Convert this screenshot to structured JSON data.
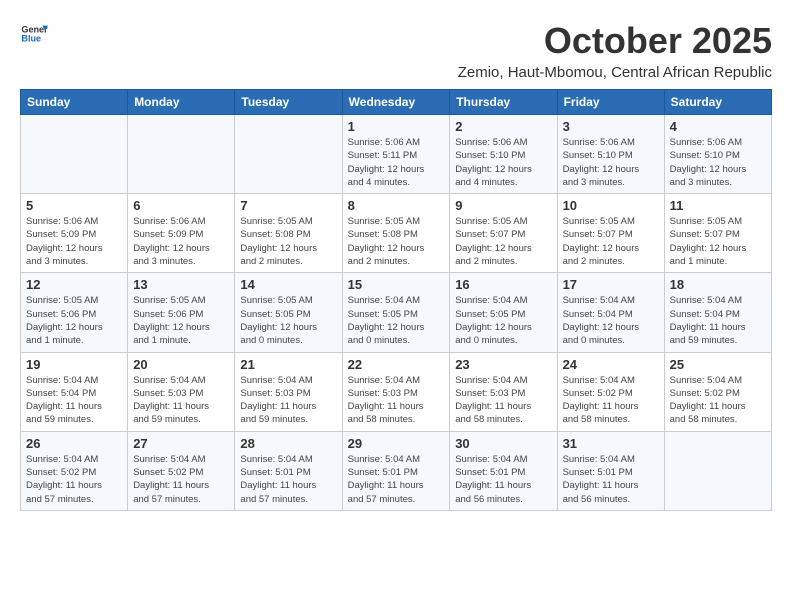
{
  "logo": {
    "line1": "General",
    "line2": "Blue"
  },
  "title": "October 2025",
  "location": "Zemio, Haut-Mbomou, Central African Republic",
  "weekdays": [
    "Sunday",
    "Monday",
    "Tuesday",
    "Wednesday",
    "Thursday",
    "Friday",
    "Saturday"
  ],
  "weeks": [
    [
      {
        "day": "",
        "info": ""
      },
      {
        "day": "",
        "info": ""
      },
      {
        "day": "",
        "info": ""
      },
      {
        "day": "1",
        "info": "Sunrise: 5:06 AM\nSunset: 5:11 PM\nDaylight: 12 hours\nand 4 minutes."
      },
      {
        "day": "2",
        "info": "Sunrise: 5:06 AM\nSunset: 5:10 PM\nDaylight: 12 hours\nand 4 minutes."
      },
      {
        "day": "3",
        "info": "Sunrise: 5:06 AM\nSunset: 5:10 PM\nDaylight: 12 hours\nand 3 minutes."
      },
      {
        "day": "4",
        "info": "Sunrise: 5:06 AM\nSunset: 5:10 PM\nDaylight: 12 hours\nand 3 minutes."
      }
    ],
    [
      {
        "day": "5",
        "info": "Sunrise: 5:06 AM\nSunset: 5:09 PM\nDaylight: 12 hours\nand 3 minutes."
      },
      {
        "day": "6",
        "info": "Sunrise: 5:06 AM\nSunset: 5:09 PM\nDaylight: 12 hours\nand 3 minutes."
      },
      {
        "day": "7",
        "info": "Sunrise: 5:05 AM\nSunset: 5:08 PM\nDaylight: 12 hours\nand 2 minutes."
      },
      {
        "day": "8",
        "info": "Sunrise: 5:05 AM\nSunset: 5:08 PM\nDaylight: 12 hours\nand 2 minutes."
      },
      {
        "day": "9",
        "info": "Sunrise: 5:05 AM\nSunset: 5:07 PM\nDaylight: 12 hours\nand 2 minutes."
      },
      {
        "day": "10",
        "info": "Sunrise: 5:05 AM\nSunset: 5:07 PM\nDaylight: 12 hours\nand 2 minutes."
      },
      {
        "day": "11",
        "info": "Sunrise: 5:05 AM\nSunset: 5:07 PM\nDaylight: 12 hours\nand 1 minute."
      }
    ],
    [
      {
        "day": "12",
        "info": "Sunrise: 5:05 AM\nSunset: 5:06 PM\nDaylight: 12 hours\nand 1 minute."
      },
      {
        "day": "13",
        "info": "Sunrise: 5:05 AM\nSunset: 5:06 PM\nDaylight: 12 hours\nand 1 minute."
      },
      {
        "day": "14",
        "info": "Sunrise: 5:05 AM\nSunset: 5:05 PM\nDaylight: 12 hours\nand 0 minutes."
      },
      {
        "day": "15",
        "info": "Sunrise: 5:04 AM\nSunset: 5:05 PM\nDaylight: 12 hours\nand 0 minutes."
      },
      {
        "day": "16",
        "info": "Sunrise: 5:04 AM\nSunset: 5:05 PM\nDaylight: 12 hours\nand 0 minutes."
      },
      {
        "day": "17",
        "info": "Sunrise: 5:04 AM\nSunset: 5:04 PM\nDaylight: 12 hours\nand 0 minutes."
      },
      {
        "day": "18",
        "info": "Sunrise: 5:04 AM\nSunset: 5:04 PM\nDaylight: 11 hours\nand 59 minutes."
      }
    ],
    [
      {
        "day": "19",
        "info": "Sunrise: 5:04 AM\nSunset: 5:04 PM\nDaylight: 11 hours\nand 59 minutes."
      },
      {
        "day": "20",
        "info": "Sunrise: 5:04 AM\nSunset: 5:03 PM\nDaylight: 11 hours\nand 59 minutes."
      },
      {
        "day": "21",
        "info": "Sunrise: 5:04 AM\nSunset: 5:03 PM\nDaylight: 11 hours\nand 59 minutes."
      },
      {
        "day": "22",
        "info": "Sunrise: 5:04 AM\nSunset: 5:03 PM\nDaylight: 11 hours\nand 58 minutes."
      },
      {
        "day": "23",
        "info": "Sunrise: 5:04 AM\nSunset: 5:03 PM\nDaylight: 11 hours\nand 58 minutes."
      },
      {
        "day": "24",
        "info": "Sunrise: 5:04 AM\nSunset: 5:02 PM\nDaylight: 11 hours\nand 58 minutes."
      },
      {
        "day": "25",
        "info": "Sunrise: 5:04 AM\nSunset: 5:02 PM\nDaylight: 11 hours\nand 58 minutes."
      }
    ],
    [
      {
        "day": "26",
        "info": "Sunrise: 5:04 AM\nSunset: 5:02 PM\nDaylight: 11 hours\nand 57 minutes."
      },
      {
        "day": "27",
        "info": "Sunrise: 5:04 AM\nSunset: 5:02 PM\nDaylight: 11 hours\nand 57 minutes."
      },
      {
        "day": "28",
        "info": "Sunrise: 5:04 AM\nSunset: 5:01 PM\nDaylight: 11 hours\nand 57 minutes."
      },
      {
        "day": "29",
        "info": "Sunrise: 5:04 AM\nSunset: 5:01 PM\nDaylight: 11 hours\nand 57 minutes."
      },
      {
        "day": "30",
        "info": "Sunrise: 5:04 AM\nSunset: 5:01 PM\nDaylight: 11 hours\nand 56 minutes."
      },
      {
        "day": "31",
        "info": "Sunrise: 5:04 AM\nSunset: 5:01 PM\nDaylight: 11 hours\nand 56 minutes."
      },
      {
        "day": "",
        "info": ""
      }
    ]
  ]
}
